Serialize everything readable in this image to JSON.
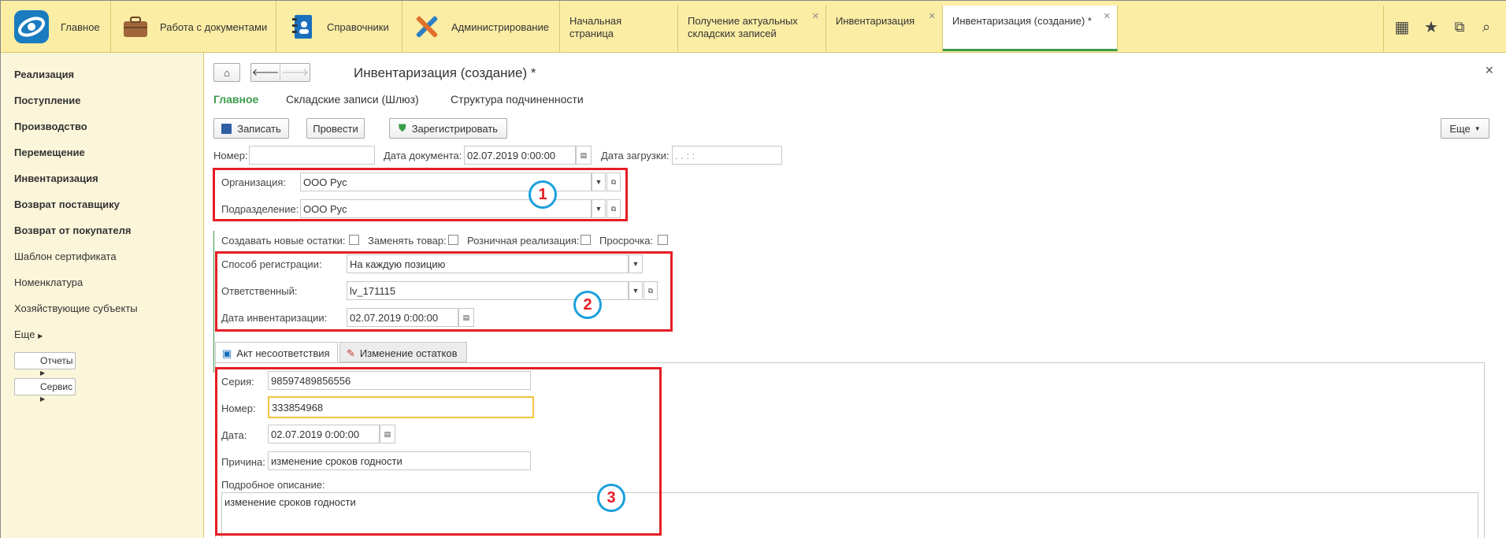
{
  "sections": [
    {
      "name": "sec-main",
      "label": "Главное"
    },
    {
      "name": "sec-docs",
      "label": "Работа с документами"
    },
    {
      "name": "sec-refs",
      "label": "Справочники"
    },
    {
      "name": "sec-admin",
      "label": "Администрирование"
    }
  ],
  "open_tabs": [
    {
      "label": "Начальная страница"
    },
    {
      "label": "Получение актуальных складских записей"
    },
    {
      "label": "Инвентаризация"
    },
    {
      "label": "Инвентаризация (создание) *"
    }
  ],
  "sidebar": {
    "items": [
      "Реализация",
      "Поступление",
      "Производство",
      "Перемещение",
      "Инвентаризация",
      "Возврат поставщику",
      "Возврат от покупателя",
      "Шаблон сертификата",
      "Номенклатура",
      "Хозяйствующие субъекты",
      "Еще"
    ],
    "reports": "Отчеты",
    "service": "Сервис"
  },
  "form": {
    "title": "Инвентаризация (создание) *",
    "nav_tabs": [
      "Главное",
      "Складские записи (Шлюз)",
      "Структура подчиненности"
    ],
    "buttons": {
      "save": "Записать",
      "post": "Провести",
      "register": "Зарегистрировать",
      "more": "Еще"
    },
    "number_label": "Номер:",
    "number_value": "",
    "doc_date_label": "Дата документа:",
    "doc_date_value": "02.07.2019  0:00:00",
    "load_date_label": "Дата загрузки:",
    "load_date_value": "  .  .        :  :",
    "org_label": "Организация:",
    "org_value": "ООО Рус",
    "dept_label": "Подразделение:",
    "dept_value": "ООО Рус",
    "checks": [
      "Создавать новые остатки:",
      "Заменять товар:",
      "Розничная реализация:",
      "Просрочка:"
    ],
    "reg_method_label": "Способ регистрации:",
    "reg_method_value": "На каждую позицию",
    "responsible_label": "Ответственный:",
    "responsible_value": "lv_171115",
    "inv_date_label": "Дата инвентаризации:",
    "inv_date_value": "02.07.2019  0:00:00",
    "sub_tabs": [
      "Акт несоответствия",
      "Изменение остатков"
    ],
    "series_label": "Серия:",
    "series_value": "98597489856556",
    "act_number_label": "Номер:",
    "act_number_value": "333854968",
    "date_label": "Дата:",
    "date_value": "02.07.2019  0:00:00",
    "reason_label": "Причина:",
    "reason_value": "изменение сроков годности",
    "desc_label": "Подробное описание:",
    "desc_value": "изменение сроков годности"
  },
  "annotations": [
    "1",
    "2",
    "3"
  ]
}
